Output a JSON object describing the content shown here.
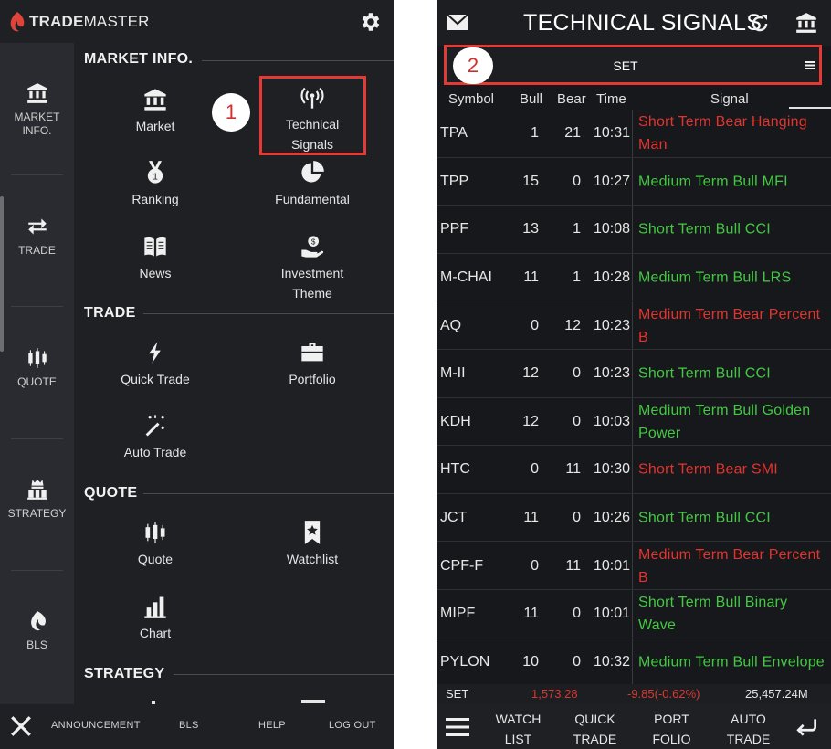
{
  "left": {
    "app_name_bold": "TRADE",
    "app_name_thin": "MASTER",
    "sidebar": [
      {
        "label": "MARKET INFO.",
        "icon": "bank-icon"
      },
      {
        "label": "TRADE",
        "icon": "exchange-arrows-icon"
      },
      {
        "label": "QUOTE",
        "icon": "candlestick-icon"
      },
      {
        "label": "STRATEGY",
        "icon": "chess-icon"
      },
      {
        "label": "BLS",
        "icon": "bls-logo-icon"
      }
    ],
    "sections": {
      "market": "MARKET INFO.",
      "trade": "TRADE",
      "quote": "QUOTE",
      "strategy": "STRATEGY"
    },
    "tiles": {
      "market": "Market",
      "technical_line1": "Technical",
      "technical_line2": "Signals",
      "ranking": "Ranking",
      "fundamental": "Fundamental",
      "news": "News",
      "investment_line1": "Investment",
      "investment_line2": "Theme",
      "quick_trade": "Quick Trade",
      "portfolio": "Portfolio",
      "auto_trade": "Auto Trade",
      "quote": "Quote",
      "watchlist": "Watchlist",
      "chart": "Chart"
    },
    "bottom": {
      "announcement": "ANNOUNCEMENT",
      "bls": "BLS",
      "help": "HELP",
      "logout": "LOG OUT"
    },
    "badge": "1"
  },
  "right": {
    "title": "TECHNICAL SIGNALS",
    "market": "SET",
    "badge": "2",
    "columns": {
      "symbol": "Symbol",
      "bull": "Bull",
      "bear": "Bear",
      "time": "Time",
      "signal": "Signal"
    },
    "rows": [
      {
        "symbol": "TPA",
        "bull": "1",
        "bear": "21",
        "time": "10:31",
        "signal": "Short Term Bear Hanging Man",
        "type": "bear"
      },
      {
        "symbol": "TPP",
        "bull": "15",
        "bear": "0",
        "time": "10:27",
        "signal": "Medium Term Bull MFI",
        "type": "bull"
      },
      {
        "symbol": "PPF",
        "bull": "13",
        "bear": "1",
        "time": "10:08",
        "signal": "Short Term Bull CCI",
        "type": "bull"
      },
      {
        "symbol": "M-CHAI",
        "bull": "11",
        "bear": "1",
        "time": "10:28",
        "signal": "Medium Term Bull LRS",
        "type": "bull"
      },
      {
        "symbol": "AQ",
        "bull": "0",
        "bear": "12",
        "time": "10:23",
        "signal": "Medium Term Bear Percent B",
        "type": "bear"
      },
      {
        "symbol": "M-II",
        "bull": "12",
        "bear": "0",
        "time": "10:23",
        "signal": "Short Term Bull CCI",
        "type": "bull"
      },
      {
        "symbol": "KDH",
        "bull": "12",
        "bear": "0",
        "time": "10:03",
        "signal": "Medium Term Bull Golden Power",
        "type": "bull"
      },
      {
        "symbol": "HTC",
        "bull": "0",
        "bear": "11",
        "time": "10:30",
        "signal": "Short Term Bear SMI",
        "type": "bear"
      },
      {
        "symbol": "JCT",
        "bull": "11",
        "bear": "0",
        "time": "10:26",
        "signal": "Short Term Bull CCI",
        "type": "bull"
      },
      {
        "symbol": "CPF-F",
        "bull": "0",
        "bear": "11",
        "time": "10:01",
        "signal": "Medium Term Bear Percent B",
        "type": "bear"
      },
      {
        "symbol": "MIPF",
        "bull": "11",
        "bear": "0",
        "time": "10:01",
        "signal": "Short Term Bull Binary Wave",
        "type": "bull"
      },
      {
        "symbol": "PYLON",
        "bull": "10",
        "bear": "0",
        "time": "10:32",
        "signal": "Medium Term Bull Envelope",
        "type": "bull"
      }
    ],
    "ticker": {
      "index": "SET",
      "value": "1,573.28",
      "change": "-9.85(-0.62%)",
      "volume": "25,457.24M"
    },
    "bottom": {
      "watch1": "WATCH",
      "watch2": "LIST",
      "quick1": "QUICK",
      "quick2": "TRADE",
      "port1": "PORT",
      "port2": "FOLIO",
      "auto1": "AUTO",
      "auto2": "TRADE"
    }
  },
  "colors": {
    "bull": "#43c843",
    "bear": "#e2342f",
    "highlight": "#e53935",
    "background": "#1f2024"
  }
}
